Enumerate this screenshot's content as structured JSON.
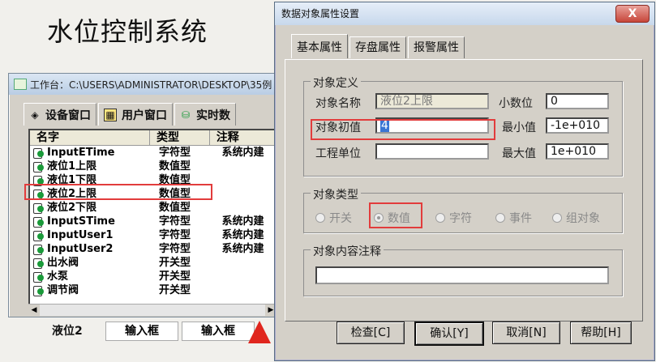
{
  "page": {
    "title": "水位控制系统"
  },
  "workbench": {
    "title": "工作台：C:\\USERS\\ADMINISTRATOR\\DESKTOP\\35例",
    "tabs": [
      "设备窗口",
      "用户窗口",
      "实时数"
    ],
    "columns": [
      "名字",
      "类型",
      "注释"
    ],
    "rows": [
      {
        "name": "InputETime",
        "type": "字符型",
        "note": "系统内建"
      },
      {
        "name": "液位1上限",
        "type": "数值型",
        "note": ""
      },
      {
        "name": "液位1下限",
        "type": "数值型",
        "note": ""
      },
      {
        "name": "液位2上限",
        "type": "数值型",
        "note": ""
      },
      {
        "name": "液位2下限",
        "type": "数值型",
        "note": ""
      },
      {
        "name": "InputSTime",
        "type": "字符型",
        "note": "系统内建"
      },
      {
        "name": "InputUser1",
        "type": "字符型",
        "note": "系统内建"
      },
      {
        "name": "InputUser2",
        "type": "字符型",
        "note": "系统内建"
      },
      {
        "name": "出水阀",
        "type": "开关型",
        "note": ""
      },
      {
        "name": "水泵",
        "type": "开关型",
        "note": ""
      },
      {
        "name": "调节阀",
        "type": "开关型",
        "note": ""
      }
    ]
  },
  "bottom": {
    "label": "液位2",
    "input1": "输入框",
    "input2": "输入框"
  },
  "dialog": {
    "title": "数据对象属性设置",
    "close": "X",
    "tabs": [
      "基本属性",
      "存盘属性",
      "报警属性"
    ],
    "def_group": "对象定义",
    "name_label": "对象名称",
    "name_value": "液位2上限",
    "init_label": "对象初值",
    "init_value": "4",
    "unit_label": "工程单位",
    "unit_value": "",
    "decimals_label": "小数位",
    "decimals_value": "0",
    "min_label": "最小值",
    "min_value": "-1e+010",
    "max_label": "最大值",
    "max_value": "1e+010",
    "type_group": "对象类型",
    "types": [
      "开关",
      "数值",
      "字符",
      "事件",
      "组对象"
    ],
    "selected_type": "数值",
    "comment_group": "对象内容注释",
    "comment_value": "",
    "buttons": {
      "check": "检查[C]",
      "ok": "确认[Y]",
      "cancel": "取消[N]",
      "help": "帮助[H]"
    }
  }
}
